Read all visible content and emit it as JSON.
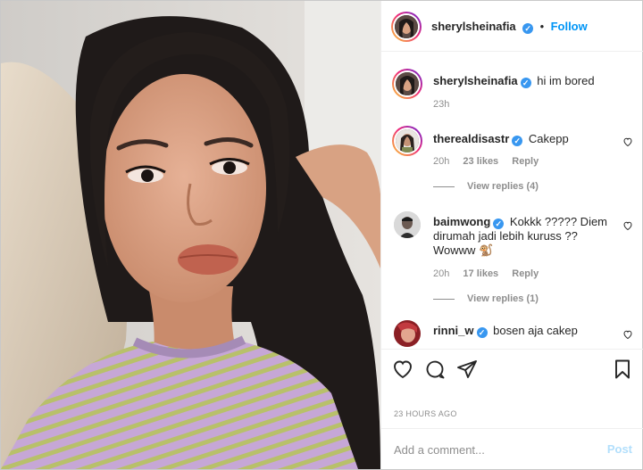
{
  "header": {
    "username": "sherylsheinafia",
    "separator": "•",
    "follow_label": "Follow",
    "verified_icon": "verified-badge-icon"
  },
  "caption": {
    "username": "sherylsheinafia",
    "text": "hi im bored",
    "time": "23h"
  },
  "comments": [
    {
      "username": "therealdisastr",
      "text": "Cakepp",
      "time": "20h",
      "likes": "23 likes",
      "reply_label": "Reply",
      "view_replies": "View replies (4)"
    },
    {
      "username": "baimwong",
      "text": "Kokkk ????? Diem dirumah jadi lebih kuruss ?? Wowww 🐒",
      "time": "20h",
      "likes": "17 likes",
      "reply_label": "Reply",
      "view_replies": "View replies (1)"
    },
    {
      "username": "rinni_w",
      "text": "bosen aja cakep"
    }
  ],
  "actions": {
    "like_icon": "heart-icon",
    "comment_icon": "comment-icon",
    "share_icon": "paper-plane-icon",
    "save_icon": "bookmark-icon"
  },
  "timestamp": "23 HOURS AGO",
  "add_comment": {
    "placeholder": "Add a comment...",
    "post_label": "Post"
  },
  "colors": {
    "accent": "#0095f6",
    "verified": "#3897f0",
    "muted": "#8e8e8e",
    "post_disabled": "#b2dffc"
  }
}
